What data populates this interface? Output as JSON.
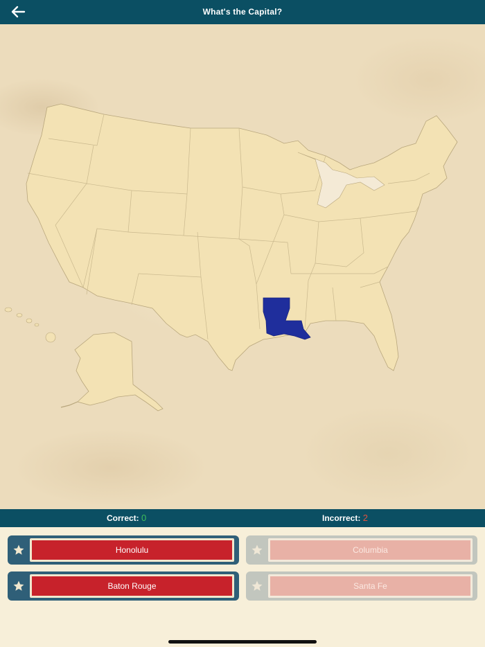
{
  "header": {
    "title": "What's the Capital?",
    "back_icon": "arrow-left-icon"
  },
  "map": {
    "highlighted_state": "Louisiana",
    "highlight_color": "#1f2e9c",
    "land_color": "#f3e2b4",
    "border_color": "#b8a67c"
  },
  "score": {
    "correct_label": "Correct:",
    "correct_value": "0",
    "incorrect_label": "Incorrect:",
    "incorrect_value": "2"
  },
  "answers": [
    {
      "label": "Honolulu",
      "state": "active"
    },
    {
      "label": "Columbia",
      "state": "dimmed"
    },
    {
      "label": "Baton Rouge",
      "state": "active"
    },
    {
      "label": "Santa Fe",
      "state": "dimmed"
    }
  ],
  "colors": {
    "header_bg": "#0b4f63",
    "answer_red": "#c7222b",
    "correct_green": "#3fbf5a",
    "incorrect_red": "#e0523f"
  }
}
